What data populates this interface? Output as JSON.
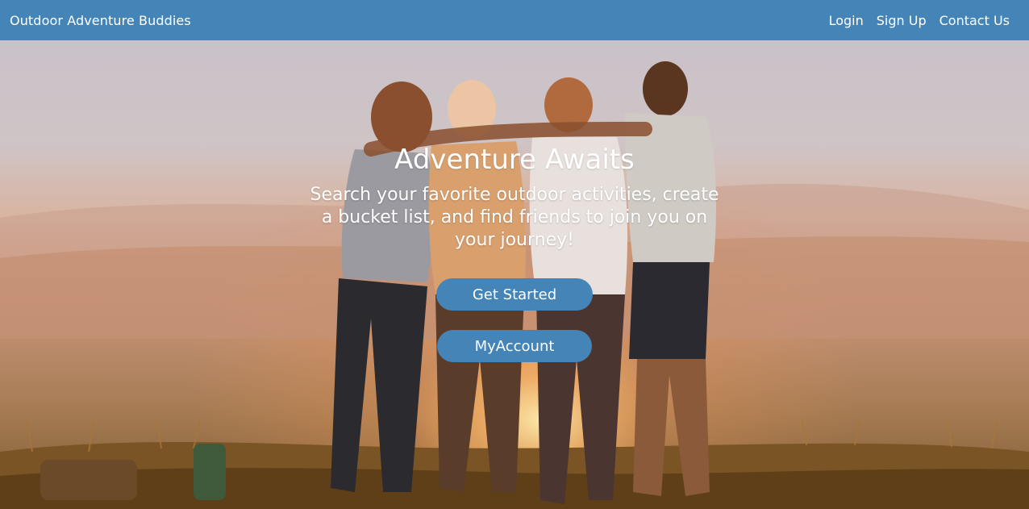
{
  "nav": {
    "brand": "Outdoor Adventure Buddies",
    "links": [
      {
        "label": "Login"
      },
      {
        "label": "Sign Up"
      },
      {
        "label": "Contact Us"
      }
    ]
  },
  "hero": {
    "title": "Adventure Awaits",
    "subtitle": "Search your favorite outdoor activities, create a bucket list, and find friends to join you on your journey!",
    "buttons": {
      "get_started": "Get Started",
      "my_account": "MyAccount"
    },
    "background_image": "group of friends embracing on a hilltop at sunset"
  },
  "colors": {
    "primary": "#4584b6",
    "text_on_primary": "#ffffff"
  }
}
